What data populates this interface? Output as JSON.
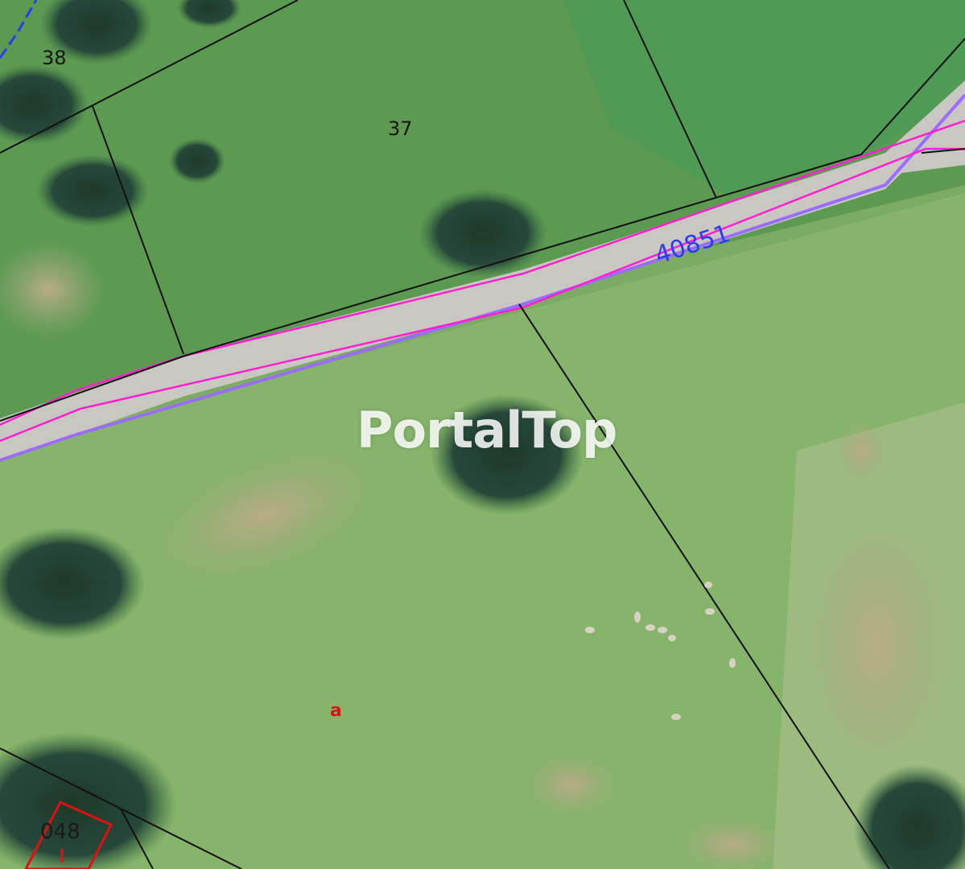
{
  "map": {
    "parcel_labels": [
      "38",
      "37"
    ],
    "road_label": "40851",
    "marker_label": "a",
    "building_label": "048",
    "colors": {
      "grass": "#6fa05a",
      "grass_light": "#8fb872",
      "road": "#c9c7c2",
      "boundary": "#111111",
      "road_outline": "#ff1fd0",
      "road_edge": "#9a6cff",
      "building": "#e01010",
      "label_blue": "#2a3cf0"
    }
  },
  "watermark": {
    "text": "PortalTop"
  }
}
